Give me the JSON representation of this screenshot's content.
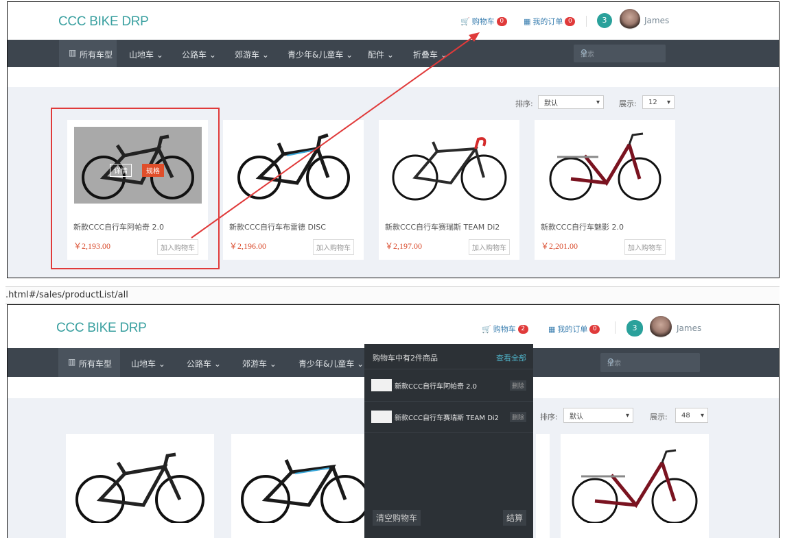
{
  "top": {
    "logo": "CCC BIKE DRP",
    "cart_label": "购物车",
    "cart_count": "0",
    "orders_label": "我的订单",
    "orders_count": "0",
    "notify_count": "3",
    "user": "James",
    "nav": [
      "所有车型",
      "山地车 ⌄",
      "公路车 ⌄",
      "郊游车 ⌄",
      "青少年&儿童车 ⌄",
      "配件 ⌄",
      "折叠车 ⌄"
    ],
    "search_placeholder": "搜索",
    "sort_label": "排序:",
    "sort_value": "默认",
    "show_label": "展示:",
    "show_value": "12",
    "products": [
      {
        "name": "新款CCC自行车阿帕奇 2.0",
        "price": "￥2,193.00",
        "add": "加入购物车"
      },
      {
        "name": "新款CCC自行车布雷德 DISC",
        "price": "￥2,196.00",
        "add": "加入购物车"
      },
      {
        "name": "新款CCC自行车赛瑞斯 TEAM Di2",
        "price": "￥2,197.00",
        "add": "加入购物车"
      },
      {
        "name": "新款CCC自行车魅影 2.0",
        "price": "￥2,201.00",
        "add": "加入购物车"
      }
    ],
    "overlay_details": "详情",
    "overlay_spec": "规格"
  },
  "url": ".html#/sales/productList/all",
  "bottom": {
    "logo": "CCC BIKE DRP",
    "cart_label": "购物车",
    "cart_count": "2",
    "orders_label": "我的订单",
    "orders_count": "0",
    "notify_count": "3",
    "user": "James",
    "nav": [
      "所有车型",
      "山地车 ⌄",
      "公路车 ⌄",
      "郊游车 ⌄",
      "青少年&儿童车 ⌄"
    ],
    "search_placeholder": "搜索",
    "sort_label": "排序:",
    "sort_value": "默认",
    "show_label": "展示:",
    "show_value": "48",
    "cart_dropdown": {
      "title": "购物车中有2件商品",
      "view_all": "查看全部",
      "items": [
        {
          "name": "新款CCC自行车阿帕奇 2.0",
          "del": "删除"
        },
        {
          "name": "新款CCC自行车赛瑞斯 TEAM Di2",
          "del": "删除"
        }
      ],
      "clear": "清空购物车",
      "checkout": "结算"
    }
  },
  "colors": {
    "accent_teal": "#2aa19b",
    "nav_bg": "#3d454e",
    "price_red": "#d94a2b",
    "highlight_red": "#e03a3a"
  },
  "icons": [
    "cart-icon",
    "orders-icon",
    "search-icon",
    "chart-icon",
    "bike-image"
  ]
}
